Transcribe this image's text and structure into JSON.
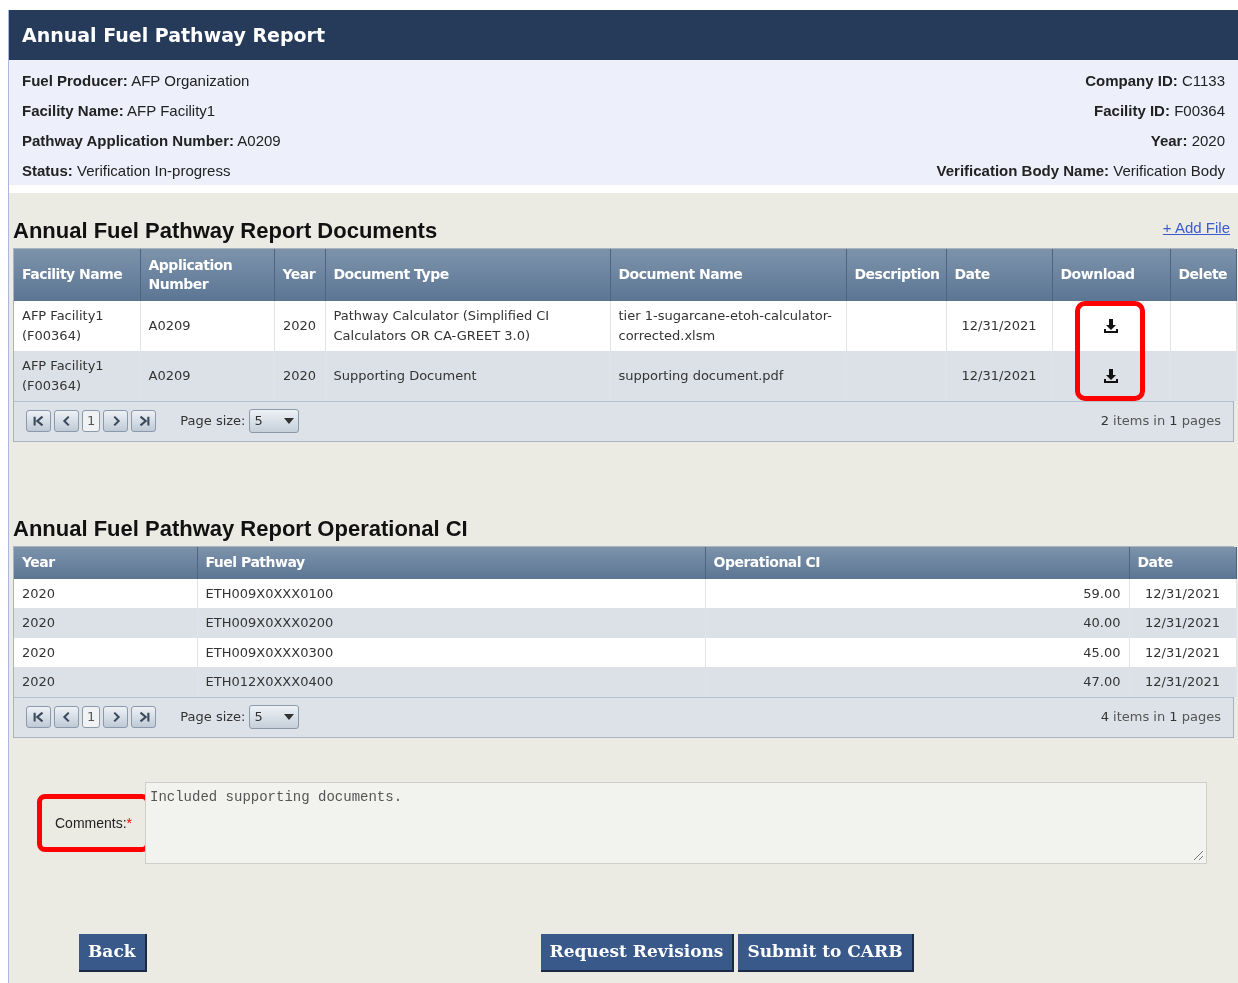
{
  "title": "Annual Fuel Pathway Report",
  "info_left": [
    {
      "label": "Fuel Producer:",
      "value": "AFP Organization"
    },
    {
      "label": "Facility Name:",
      "value": "AFP Facility1"
    },
    {
      "label": "Pathway Application Number:",
      "value": "A0209"
    },
    {
      "label": "Status:",
      "value": "Verification In-progress"
    }
  ],
  "info_right": [
    {
      "label": "Company ID:",
      "value": "C1133"
    },
    {
      "label": "Facility ID:",
      "value": "F00364"
    },
    {
      "label": "Year:",
      "value": "2020"
    },
    {
      "label": "Verification Body Name:",
      "value": "Verification Body"
    }
  ],
  "documents": {
    "heading": "Annual Fuel Pathway Report Documents",
    "add_link": "+ Add File",
    "download_highlighted": true,
    "columns": [
      "Facility Name",
      "Application Number",
      "Year",
      "Document Type",
      "Document Name",
      "Description",
      "Date",
      "Download",
      "Delete"
    ],
    "rows": [
      {
        "facility": "AFP Facility1 (F00364)",
        "application": "A0209",
        "year": "2020",
        "type": "Pathway Calculator (Simplified CI Calculators OR CA-GREET 3.0)",
        "name": "tier 1-sugarcane-etoh-calculator-corrected.xlsm",
        "date": "12/31/2021"
      },
      {
        "facility": "AFP Facility1 (F00364)",
        "application": "A0209",
        "year": "2020",
        "type": "Supporting Document",
        "name": "supporting document.pdf",
        "date": "12/31/2021"
      }
    ],
    "pager": {
      "page": "1",
      "page_size_label": "Page size:",
      "page_size": "5",
      "count": "2",
      "items_text": "items in",
      "pages": "1",
      "pages_text": "pages"
    }
  },
  "operational": {
    "heading": "Annual Fuel Pathway Report Operational CI",
    "columns": [
      "Year",
      "Fuel Pathway",
      "Operational CI",
      "Date"
    ],
    "rows": [
      {
        "year": "2020",
        "pathway": "ETH009X0XXX0100",
        "ci": "59.00",
        "date": "12/31/2021"
      },
      {
        "year": "2020",
        "pathway": "ETH009X0XXX0200",
        "ci": "40.00",
        "date": "12/31/2021"
      },
      {
        "year": "2020",
        "pathway": "ETH009X0XXX0300",
        "ci": "45.00",
        "date": "12/31/2021"
      },
      {
        "year": "2020",
        "pathway": "ETH012X0XXX0400",
        "ci": "47.00",
        "date": "12/31/2021"
      }
    ],
    "pager": {
      "page": "1",
      "page_size_label": "Page size:",
      "page_size": "5",
      "count": "4",
      "items_text": "items in",
      "pages": "1",
      "pages_text": "pages"
    }
  },
  "comments": {
    "label": "Comments:",
    "required_mark": "*",
    "value": "Included supporting documents.",
    "highlighted": true
  },
  "buttons": {
    "back": "Back",
    "request": "Request Revisions",
    "submit": "Submit to CARB"
  }
}
